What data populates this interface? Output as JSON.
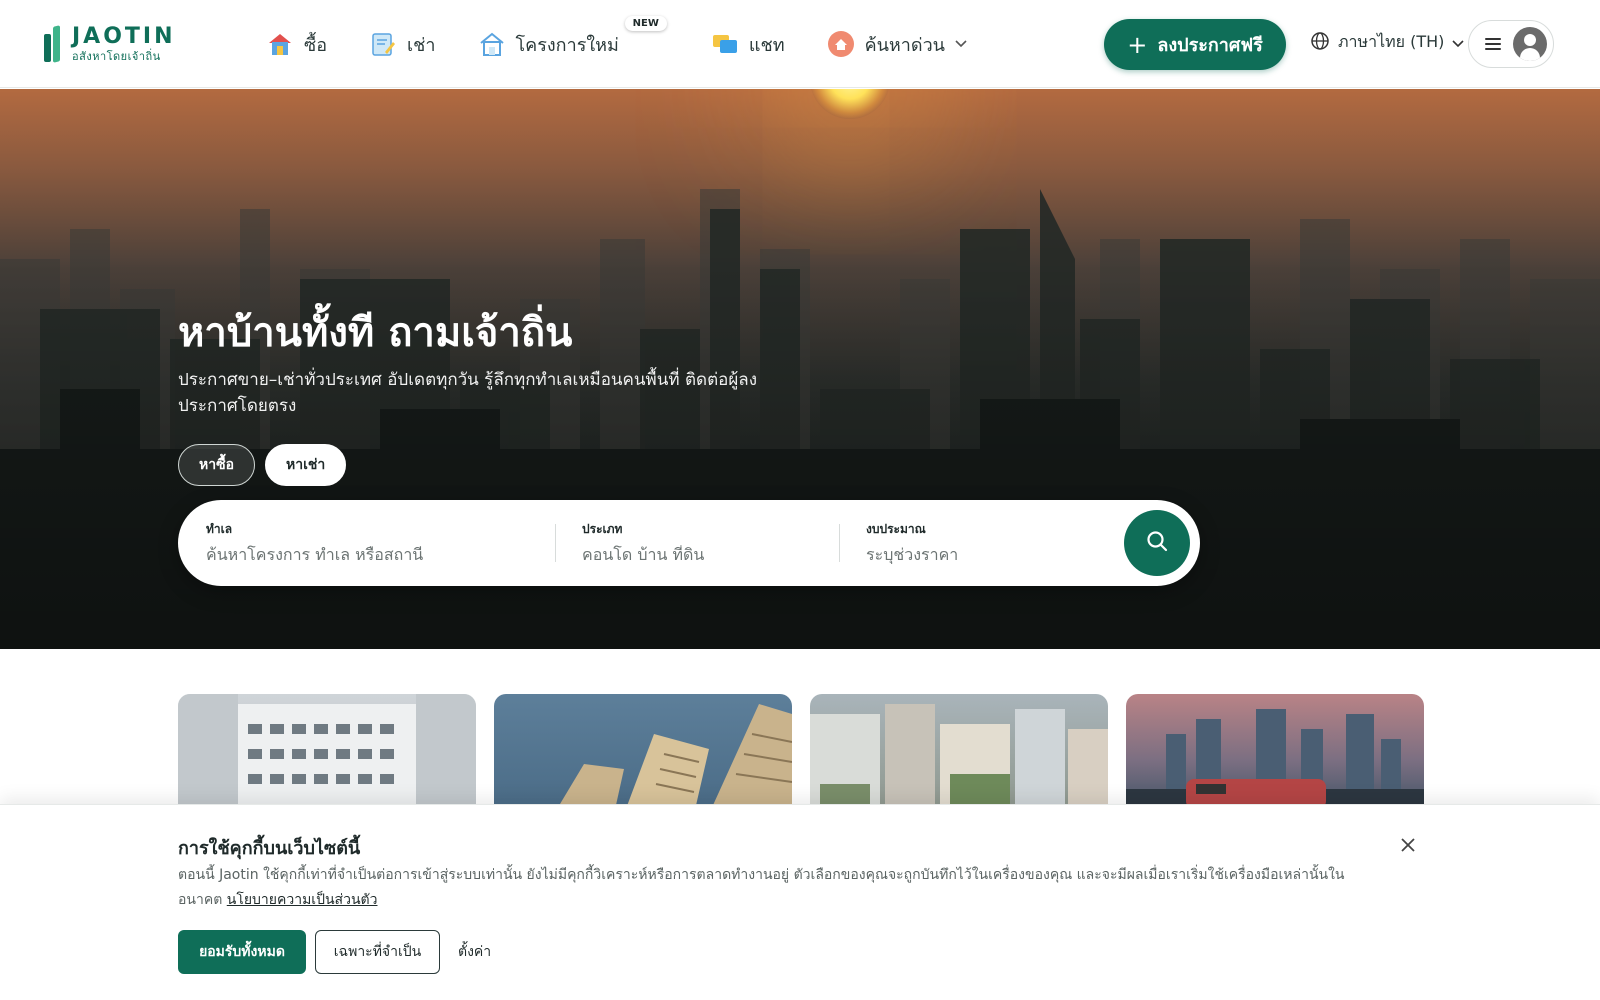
{
  "brand": {
    "name": "JAOTIN",
    "tagline": "อสังหาโดยเจ้าถิ่น",
    "primary_color": "#0f6e58"
  },
  "nav": {
    "items": [
      {
        "label": "ซื้อ",
        "icon": "house-buy-icon"
      },
      {
        "label": "เช่า",
        "icon": "rent-document-icon"
      },
      {
        "label": "โครงการใหม่",
        "icon": "new-project-icon",
        "badge": "NEW"
      },
      {
        "label": "แชท",
        "icon": "chat-bubbles-icon"
      },
      {
        "label": "ค้นหาด่วน",
        "icon": "quick-search-icon",
        "has_dropdown": true
      }
    ],
    "post_button": "ลงประกาศฟรี",
    "language": "ภาษาไทย (TH)"
  },
  "hero": {
    "title": "หาบ้านทั้งที ถามเจ้าถิ่น",
    "subtitle": "ประกาศขาย–เช่าทั่วประเทศ อัปเดตทุกวัน รู้ลึกทุกทำเลเหมือนคนพื้นที่ ติดต่อผู้ลงประกาศโดยตรง",
    "tabs": [
      "หาซื้อ",
      "หาเช่า"
    ],
    "active_tab": "หาเช่า"
  },
  "search": {
    "location": {
      "label": "ทำเล",
      "placeholder": "ค้นหาโครงการ ทำเล หรือสถานี"
    },
    "type": {
      "label": "ประเภท",
      "placeholder": "คอนโด บ้าน ที่ดิน"
    },
    "budget": {
      "label": "งบประมาณ",
      "placeholder": "ระบุช่วงราคา"
    }
  },
  "cards": [
    {
      "name": "apartment-building-photo"
    },
    {
      "name": "highrise-towers-photo"
    },
    {
      "name": "city-rooftops-photo"
    },
    {
      "name": "skyline-skytrain-photo"
    }
  ],
  "cookie": {
    "title": "การใช้คุกกี้บนเว็บไซต์นี้",
    "text": "ตอนนี้ Jaotin ใช้คุกกี้เท่าที่จำเป็นต่อการเข้าสู่ระบบเท่านั้น ยังไม่มีคุกกี้วิเคราะห์หรือการตลาดทำงานอยู่ ตัวเลือกของคุณจะถูกบันทึกไว้ในเครื่องของคุณ และจะมีผลเมื่อเราเริ่มใช้เครื่องมือเหล่านั้นในอนาคต",
    "link": "นโยบายความเป็นส่วนตัว",
    "accept_all": "ยอมรับทั้งหมด",
    "necessary_only": "เฉพาะที่จำเป็น",
    "settings": "ตั้งค่า"
  }
}
